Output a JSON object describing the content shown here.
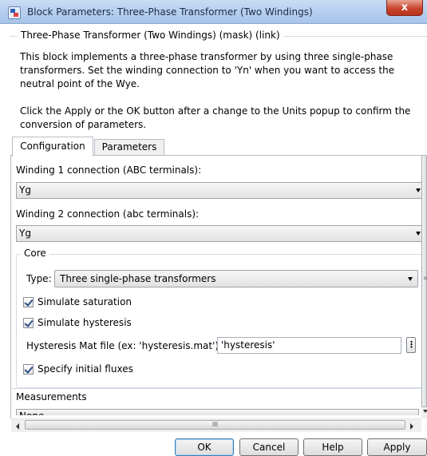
{
  "window": {
    "title": "Block Parameters: Three-Phase Transformer (Two Windings)",
    "close_label": "x"
  },
  "mask": {
    "title": "Three-Phase Transformer (Two Windings) (mask) (link)",
    "description_1": "This block implements a three-phase transformer by using three single-phase transformers. Set the winding connection to 'Yn'  when you want to access the neutral point of the Wye.",
    "description_2": "Click the Apply or the OK button after a change to the Units popup to confirm the conversion of parameters."
  },
  "tabs": [
    {
      "label": "Configuration",
      "active": true
    },
    {
      "label": "Parameters",
      "active": false
    }
  ],
  "configuration": {
    "winding1_label": "Winding 1 connection (ABC terminals):",
    "winding1_value": "Yg",
    "winding2_label": "Winding 2 connection (abc terminals):",
    "winding2_value": "Yg",
    "core": {
      "title": "Core",
      "type_label": "Type:",
      "type_value": "Three single-phase transformers",
      "simulate_saturation": {
        "label": "Simulate saturation",
        "checked": true
      },
      "simulate_hysteresis": {
        "label": "Simulate hysteresis",
        "checked": true
      },
      "hysteresis_file_label": "Hysteresis Mat file (ex: 'hysteresis.mat')",
      "hysteresis_file_value": "'hysteresis'",
      "browse_label": "⋮",
      "specify_initial_fluxes": {
        "label": "Specify initial fluxes",
        "checked": true
      }
    },
    "measurements_label": "Measurements",
    "measurements_value": "None"
  },
  "scrollbar": {
    "grip": "III"
  },
  "buttons": {
    "ok": "OK",
    "cancel": "Cancel",
    "help": "Help",
    "apply": "Apply"
  }
}
